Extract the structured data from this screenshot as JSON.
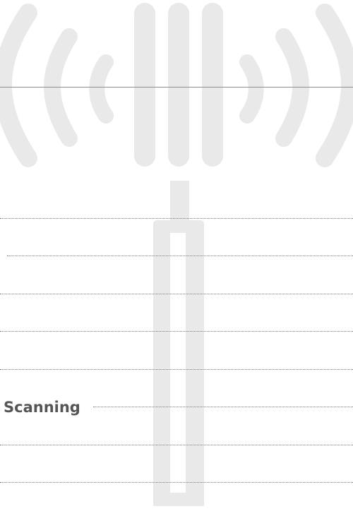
{
  "background": {
    "icon": "signal-tower-icon",
    "color": "#e9e9e9"
  },
  "list": {
    "items": [
      {
        "label": ""
      },
      {
        "label": ""
      },
      {
        "label": ""
      },
      {
        "label": ""
      },
      {
        "label": ""
      },
      {
        "label": "Scanning"
      },
      {
        "label": ""
      },
      {
        "label": ""
      }
    ]
  },
  "colors": {
    "text": "#555555",
    "divider": "#8e8e8e",
    "leader_dots": "#7a7a7a"
  }
}
